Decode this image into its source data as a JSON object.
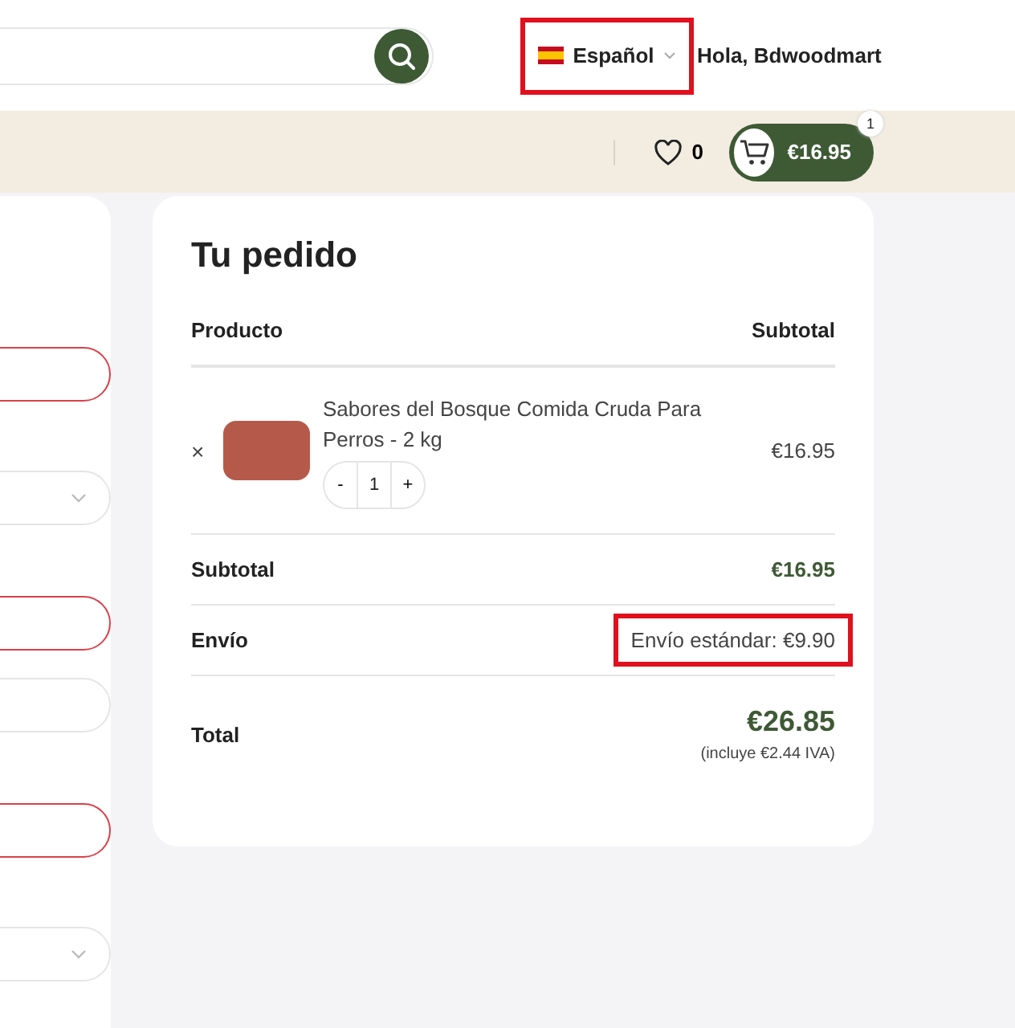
{
  "header": {
    "language": {
      "label": "Español",
      "highlighted": true
    },
    "greeting": "Hola, Bdwoodmart"
  },
  "toolbar": {
    "wishlist_count": "0",
    "cart_total": "€16.95",
    "cart_badge": "1"
  },
  "form_fields": [
    {
      "kind": "input",
      "error": true
    },
    {
      "kind": "select",
      "error": false
    },
    {
      "kind": "input",
      "error": true
    },
    {
      "kind": "input",
      "error": false
    },
    {
      "kind": "input",
      "error": true
    },
    {
      "kind": "select",
      "error": false
    }
  ],
  "order": {
    "title": "Tu pedido",
    "columns": [
      "Producto",
      "Subtotal"
    ],
    "items": [
      {
        "remove": "×",
        "name": "Sabores del Bosque Comida Cruda Para Perros - 2 kg",
        "minus": "-",
        "quantity": "1",
        "plus": "+",
        "subtotal": "€16.95"
      }
    ],
    "subtotal": {
      "label": "Subtotal",
      "value": "€16.95"
    },
    "shipping": {
      "label": "Envío",
      "value": "Envío estándar: €9.90",
      "highlighted": true
    },
    "total": {
      "label": "Total",
      "value": "€26.85",
      "note": "(incluye €2.44 IVA)"
    }
  }
}
